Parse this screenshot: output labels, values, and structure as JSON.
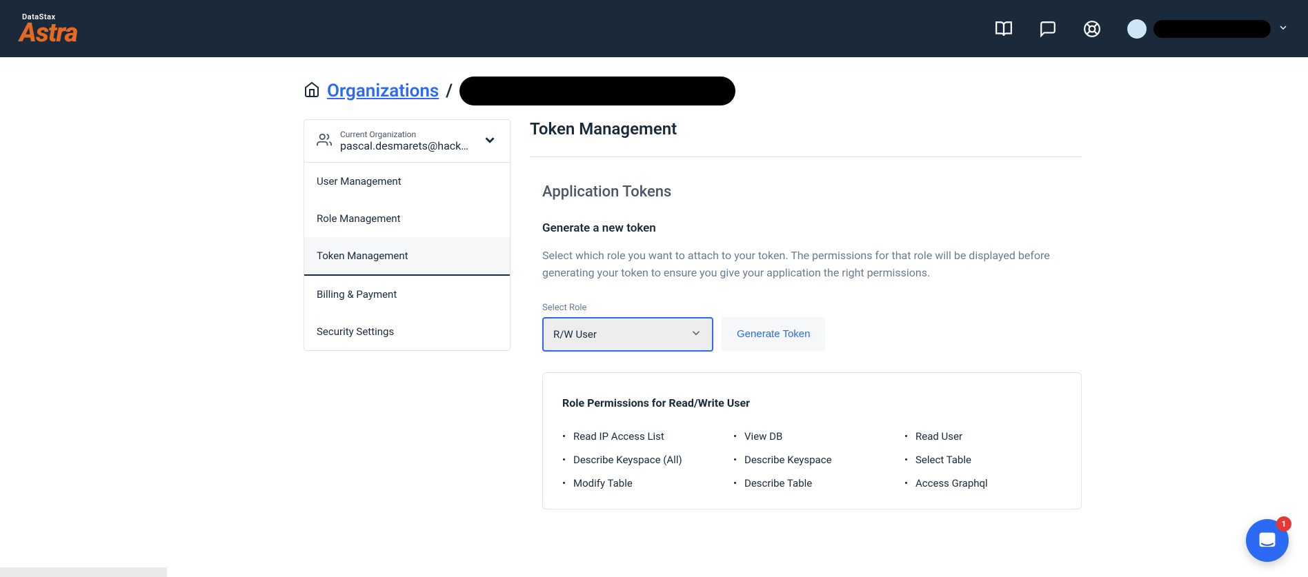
{
  "brand": {
    "tag": "DataStax",
    "name": "Astra"
  },
  "breadcrumb": {
    "organizations": "Organizations"
  },
  "org_switcher": {
    "label": "Current Organization",
    "value": "pascal.desmarets@hack…"
  },
  "sidebar": {
    "items": [
      {
        "label": "User Management"
      },
      {
        "label": "Role Management"
      },
      {
        "label": "Token Management"
      },
      {
        "label": "Billing & Payment"
      },
      {
        "label": "Security Settings"
      }
    ],
    "activeIndex": 2
  },
  "main": {
    "title": "Token Management",
    "sectionTitle": "Application Tokens",
    "generateHeading": "Generate a new token",
    "description": "Select which role you want to attach to your token. The permissions for that role will be displayed before generating your token to ensure you give your application the right permissions.",
    "roleLabel": "Select Role",
    "selectedRole": "R/W User",
    "generateButton": "Generate Token",
    "permissionsTitle": "Role Permissions for Read/Write User",
    "permissions": {
      "col1": [
        "Read IP Access List",
        "Describe Keyspace (All)",
        "Modify Table"
      ],
      "col2": [
        "View DB",
        "Describe Keyspace",
        "Describe Table"
      ],
      "col3": [
        "Read User",
        "Select Table",
        "Access Graphql"
      ]
    }
  },
  "chat": {
    "badge": "1"
  }
}
